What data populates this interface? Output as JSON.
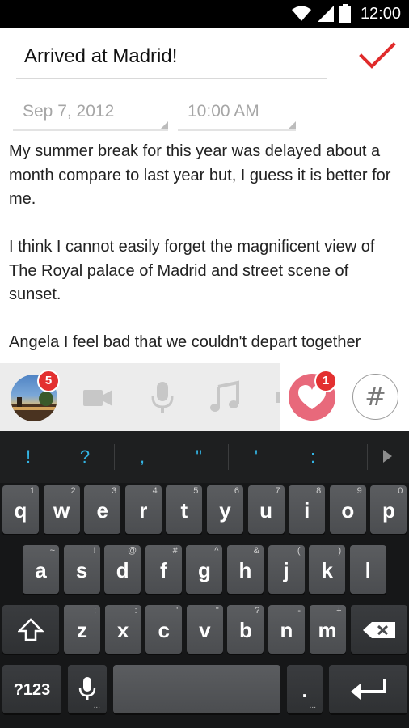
{
  "status_bar": {
    "time": "12:00",
    "icons": [
      "wifi-icon",
      "cell-signal-icon",
      "battery-icon"
    ]
  },
  "entry": {
    "title": "Arrived at Madrid!",
    "date": "Sep 7, 2012",
    "time": "10:00 AM",
    "paragraphs": [
      "My summer break for this year was delayed about a month compare to last year but, I guess it is better for me.",
      "I think I cannot easily forget the magnificent view of The Royal palace of Madrid and street scene of sunset.",
      "Angela I feel bad that we couldn't depart together"
    ]
  },
  "attachments": {
    "photo_badge": "5",
    "heart_badge": "1",
    "hash_label": "#",
    "icons": [
      "photo-thumbnail",
      "video-camera-icon",
      "microphone-icon",
      "music-note-icon",
      "heart-icon",
      "hashtag-icon"
    ]
  },
  "keyboard": {
    "suggestions": [
      "!",
      "?",
      ",",
      "\"",
      "'",
      ":"
    ],
    "row1": [
      {
        "label": "q",
        "hint": "1"
      },
      {
        "label": "w",
        "hint": "2"
      },
      {
        "label": "e",
        "hint": "3"
      },
      {
        "label": "r",
        "hint": "4"
      },
      {
        "label": "t",
        "hint": "5"
      },
      {
        "label": "y",
        "hint": "6"
      },
      {
        "label": "u",
        "hint": "7"
      },
      {
        "label": "i",
        "hint": "8"
      },
      {
        "label": "o",
        "hint": "9"
      },
      {
        "label": "p",
        "hint": "0"
      }
    ],
    "row2": [
      {
        "label": "a",
        "hint": "~"
      },
      {
        "label": "s",
        "hint": "!"
      },
      {
        "label": "d",
        "hint": "@"
      },
      {
        "label": "f",
        "hint": "#"
      },
      {
        "label": "g",
        "hint": "^"
      },
      {
        "label": "h",
        "hint": "&"
      },
      {
        "label": "j",
        "hint": "("
      },
      {
        "label": "k",
        "hint": ")"
      },
      {
        "label": "l",
        "hint": ""
      }
    ],
    "row3": [
      {
        "label": "z",
        "hint": ";"
      },
      {
        "label": "x",
        "hint": ":"
      },
      {
        "label": "c",
        "hint": "'"
      },
      {
        "label": "v",
        "hint": "\""
      },
      {
        "label": "b",
        "hint": "?"
      },
      {
        "label": "n",
        "hint": "-"
      },
      {
        "label": "m",
        "hint": "+"
      }
    ],
    "symbols_key": "?123",
    "period_key": ".",
    "ellipsis": "..."
  },
  "colors": {
    "accent_red": "#e02b2b",
    "suggestion_blue": "#33b5e5",
    "heart_pink": "#e8697b",
    "badge_red": "#e33030"
  }
}
